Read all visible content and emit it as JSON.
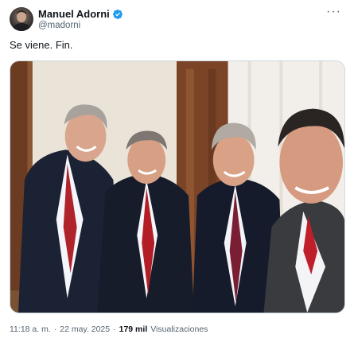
{
  "author": {
    "name": "Manuel Adorni",
    "handle": "@madorni",
    "verified": true,
    "avatar_icon": "profile-photo",
    "verified_icon": "verified-badge-icon",
    "more_icon": "more-dots-icon"
  },
  "post": {
    "text": "Se viene. Fin.",
    "time": "11:18 a. m.",
    "separator": "·",
    "date": "22 may. 2025",
    "views_count": "179 mil",
    "views_label": "Visualizaciones"
  },
  "colors": {
    "verified_blue": "#1d9bf0",
    "secondary_text": "#536471",
    "primary_text": "#0f1419"
  }
}
